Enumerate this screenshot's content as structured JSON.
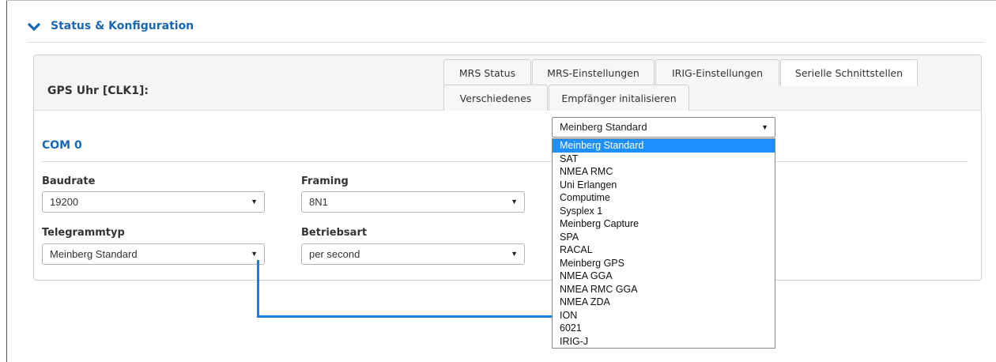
{
  "section": {
    "title": "Status & Konfiguration"
  },
  "panel": {
    "title": "GPS Uhr [CLK1]:"
  },
  "tabs": [
    {
      "label": "MRS Status"
    },
    {
      "label": "MRS-Einstellungen"
    },
    {
      "label": "IRIG-Einstellungen"
    },
    {
      "label": "Serielle Schnittstellen",
      "active": true
    },
    {
      "label": "Verschiedenes"
    },
    {
      "label": "Empfänger initalisieren"
    }
  ],
  "com": {
    "title": "COM 0",
    "baudrate": {
      "label": "Baudrate",
      "value": "19200"
    },
    "framing": {
      "label": "Framing",
      "value": "8N1"
    },
    "telegrammtyp": {
      "label": "Telegrammtyp",
      "value": "Meinberg Standard"
    },
    "betriebsart": {
      "label": "Betriebsart",
      "value": "per second"
    }
  },
  "dropdown": {
    "value": "Meinberg Standard",
    "selected_index": 0,
    "options": [
      "Meinberg Standard",
      "SAT",
      "NMEA RMC",
      "Uni Erlangen",
      "Computime",
      "Sysplex 1",
      "Meinberg Capture",
      "SPA",
      "RACAL",
      "Meinberg GPS",
      "NMEA GGA",
      "NMEA RMC GGA",
      "NMEA ZDA",
      "ION",
      "6021",
      "IRIG-J"
    ]
  },
  "colors": {
    "accent": "#1a67b3",
    "highlight": "#1e90ff",
    "connector": "#1a7fe0"
  }
}
